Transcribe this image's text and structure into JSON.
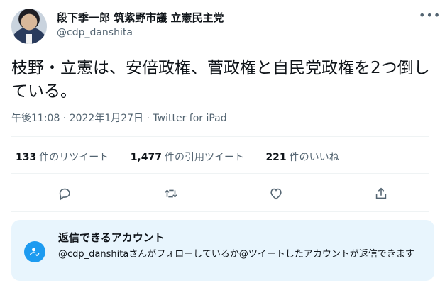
{
  "author": {
    "display_name": "段下季一郎 筑紫野市議 立憲民主党",
    "handle": "@cdp_danshita"
  },
  "tweet": {
    "text": "枝野・立憲は、安倍政権、菅政権と自民党政権を2つ倒している。",
    "meta": "午後11:08 · 2022年1月27日 · Twitter for iPad"
  },
  "stats": [
    {
      "count": "133",
      "label": "件のリツイート"
    },
    {
      "count": "1,477",
      "label": "件の引用ツイート"
    },
    {
      "count": "221",
      "label": "件のいいね"
    }
  ],
  "actions": {
    "reply": "reply-icon",
    "retweet": "retweet-icon",
    "like": "heart-icon",
    "share": "share-icon"
  },
  "reply_settings": {
    "title": "返信できるアカウント",
    "description": "@cdp_danshitaさんがフォローしているか@ツイートしたアカウントが返信できます"
  },
  "colors": {
    "accent": "#1d9bf0",
    "muted": "#536471",
    "info_bg": "#e8f5fd"
  }
}
